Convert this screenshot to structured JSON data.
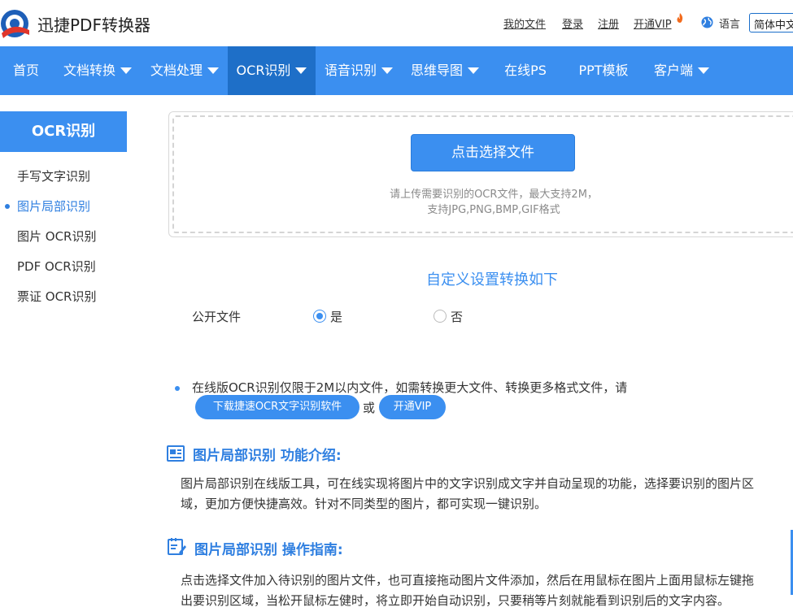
{
  "header": {
    "brand": "迅捷PDF转换器",
    "links": [
      "我的文件",
      "登录",
      "注册",
      "开通VIP"
    ],
    "lang_label": "语言",
    "lang_value": "简体中文"
  },
  "nav": {
    "items": [
      {
        "label": "首页"
      },
      {
        "label": "文档转换"
      },
      {
        "label": "文档处理"
      },
      {
        "label": "OCR识别"
      },
      {
        "label": "语音识别"
      },
      {
        "label": "思维导图"
      },
      {
        "label": "在线PS"
      },
      {
        "label": "PPT模板"
      },
      {
        "label": "客户端"
      }
    ]
  },
  "sidebar": {
    "title": "OCR识别",
    "items": [
      {
        "label": "手写文字识别"
      },
      {
        "label": "图片局部识别"
      },
      {
        "label": "图片 OCR识别"
      },
      {
        "label": "PDF OCR识别"
      },
      {
        "label": "票证 OCR识别"
      }
    ]
  },
  "upload": {
    "button": "点击选择文件",
    "hint_line1": "请上传需要识别的OCR文件，最大支持2M，",
    "hint_line2": "支持JPG,PNG,BMP,GIF格式"
  },
  "settings": {
    "title": "自定义设置转换如下",
    "option_label": "公开文件",
    "yes": "是",
    "no": "否"
  },
  "notice": {
    "text": "在线版OCR识别仅限于2M以内文件，如需转换更大文件、转换更多格式文件，请",
    "download_btn": "下载捷速OCR文字识别软件",
    "or": "或",
    "vip_btn": "开通VIP"
  },
  "intro": {
    "title": "图片局部识别 功能介绍:",
    "line1": "图片局部识别在线版工具，可在线实现将图片中的文字识别成文字并自动呈现的功能，选择要识别的图片区",
    "line2": "域，更加方便快捷高效。针对不同类型的图片，都可实现一键识别。"
  },
  "guide": {
    "title": "图片局部识别 操作指南:",
    "line1": "点击选择文件加入待识别的图片文件，也可直接拖动图片文件添加，然后在用鼠标在图片上面用鼠标左键拖",
    "line2": "出要识别区域，当松开鼠标左健时，将立即开始自动识别，只要稍等片刻就能看到识别后的文字内容。"
  },
  "colors": {
    "primary": "#3b8ff0",
    "nav_active": "#1e6fc8"
  }
}
